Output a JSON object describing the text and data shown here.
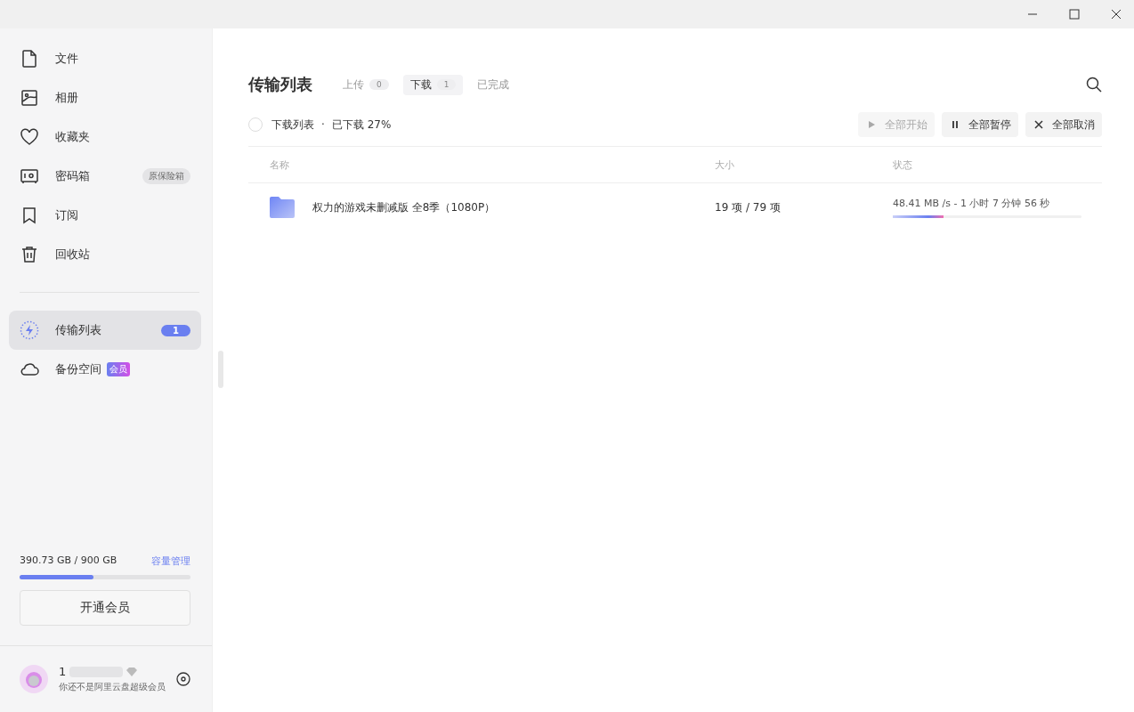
{
  "sidebar": {
    "items": [
      {
        "label": "文件",
        "selected": false
      },
      {
        "label": "相册",
        "selected": false
      },
      {
        "label": "收藏夹",
        "selected": false
      },
      {
        "label": "密码箱",
        "selected": false,
        "badge": {
          "kind": "tag",
          "text": "原保险箱"
        }
      },
      {
        "label": "订阅",
        "selected": false
      },
      {
        "label": "回收站",
        "selected": false
      }
    ],
    "items2": [
      {
        "label": "传输列表",
        "selected": true,
        "badge": {
          "kind": "count",
          "text": "1"
        }
      },
      {
        "label": "备份空间",
        "selected": false,
        "badge": {
          "kind": "vip",
          "text": "会员"
        }
      }
    ],
    "storage": {
      "text": "390.73 GB / 900 GB",
      "link": "容量管理",
      "level": 0.43
    },
    "upgrade_button": "开通会员",
    "user": {
      "name": "1",
      "subtitle": "你还不是阿里云盘超级会员"
    }
  },
  "main": {
    "title": "传输列表",
    "tabs": [
      {
        "label": "上传",
        "count": "0",
        "selected": false
      },
      {
        "label": "下载",
        "count": "1",
        "selected": true
      },
      {
        "label": "已完成",
        "selected": false
      }
    ],
    "list_header": {
      "checked": false,
      "label": "下载列表",
      "separator": "·",
      "summary": "已下载 27%"
    },
    "actions": [
      {
        "kind": "start",
        "label": "全部开始",
        "disabled": true
      },
      {
        "kind": "pause",
        "label": "全部暂停",
        "disabled": false
      },
      {
        "kind": "cancel",
        "label": "全部取消",
        "disabled": false
      }
    ],
    "columns": [
      "名称",
      "大小",
      "状态"
    ],
    "rows": [
      {
        "name": "权力的游戏未删减版 全8季（1080P）",
        "size": "19 项 / 79 项",
        "status": "48.41 MB /s - 1 小时 7 分钟 56 秒",
        "level": 0.27
      }
    ]
  }
}
